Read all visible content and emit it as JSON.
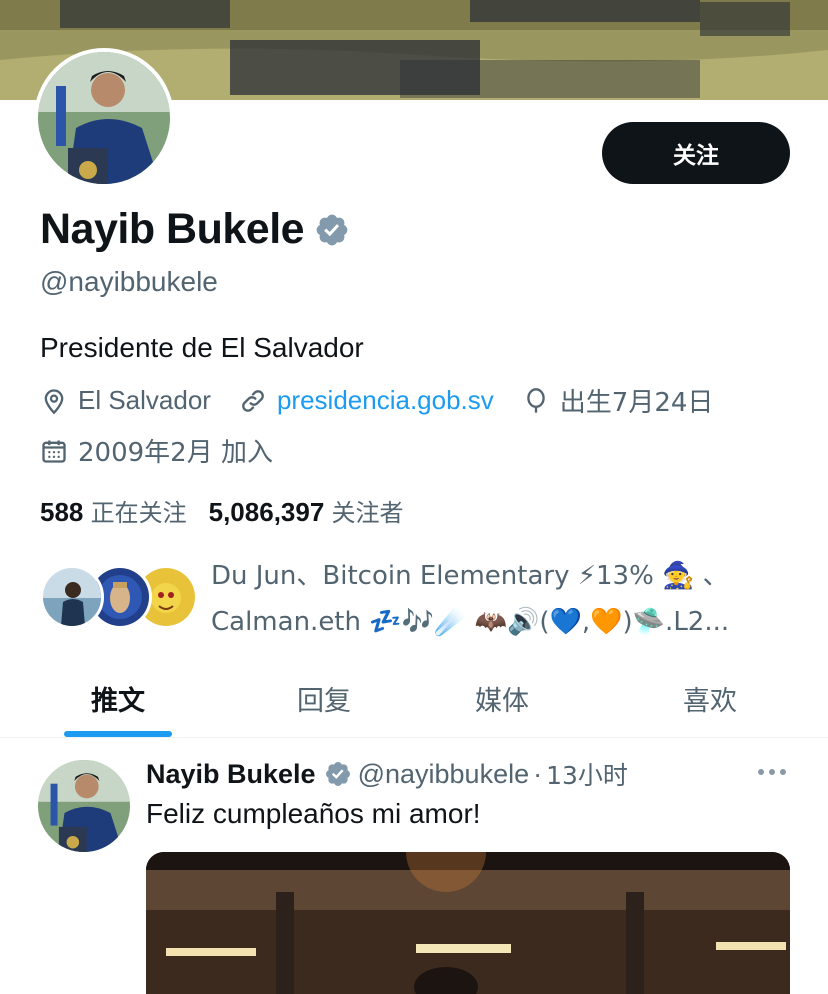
{
  "profile": {
    "display_name": "Nayib Bukele",
    "handle": "@nayibbukele",
    "bio": "Presidente de El Salvador",
    "location": "El Salvador",
    "website": "presidencia.gob.sv",
    "birthday": "出生7月24日",
    "joined": "2009年2月 加入",
    "follow_label": "关注"
  },
  "stats": {
    "following_count": "588",
    "following_label": "正在关注",
    "followers_count": "5,086,397",
    "followers_label": "关注者"
  },
  "followed_by": {
    "line1": "Du Jun、Bitcoin Elementary ⚡13% 🧙 、",
    "line2": "Calman.eth 💤🎶☄️ 🦇🔊(💙,🧡)🛸.L2..."
  },
  "tabs": [
    {
      "label": "推文"
    },
    {
      "label": "回复"
    },
    {
      "label": "媒体"
    },
    {
      "label": "喜欢"
    }
  ],
  "tweet": {
    "name": "Nayib Bukele",
    "handle": "@nayibbukele",
    "separator": "·",
    "time": "13小时",
    "text": "Feliz cumpleaños mi amor!"
  },
  "colors": {
    "accent": "#1d9bf0",
    "verified": "#829aab",
    "button_bg": "#0f1419",
    "muted_text": "#536471"
  },
  "icons": {
    "verified": "verified-badge-icon",
    "location": "location-pin-icon",
    "link": "link-icon",
    "birthday": "balloon-icon",
    "calendar": "calendar-icon",
    "more": "more-dots-icon"
  }
}
